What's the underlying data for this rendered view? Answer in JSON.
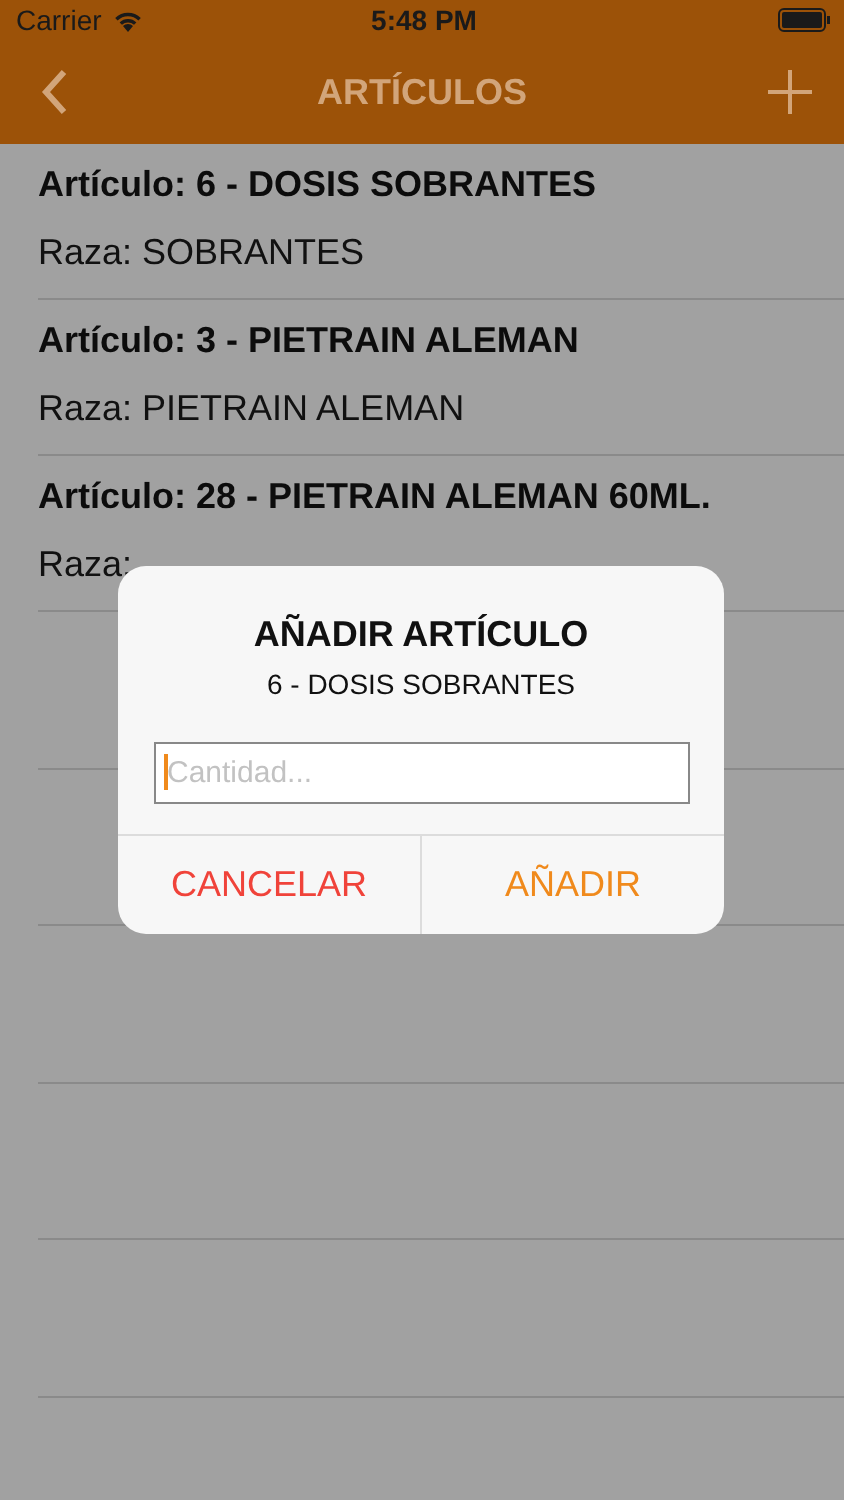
{
  "status_bar": {
    "carrier": "Carrier",
    "time": "5:48 PM"
  },
  "nav": {
    "title": "ARTÍCULOS"
  },
  "items": [
    {
      "title": "Artículo: 6 - DOSIS SOBRANTES",
      "subtitle": "Raza: SOBRANTES"
    },
    {
      "title": "Artículo: 3 - PIETRAIN ALEMAN",
      "subtitle": "Raza: PIETRAIN ALEMAN"
    },
    {
      "title": "Artículo: 28 - PIETRAIN ALEMAN 60ML.",
      "subtitle": "Raza:"
    }
  ],
  "dialog": {
    "title": "AÑADIR ARTÍCULO",
    "message": "6 - DOSIS SOBRANTES",
    "input": {
      "placeholder": "Cantidad...",
      "focused": true
    },
    "buttons": [
      {
        "label": "CANCELAR",
        "kind": "destructive"
      },
      {
        "label": "AÑADIR",
        "kind": "default"
      }
    ]
  }
}
